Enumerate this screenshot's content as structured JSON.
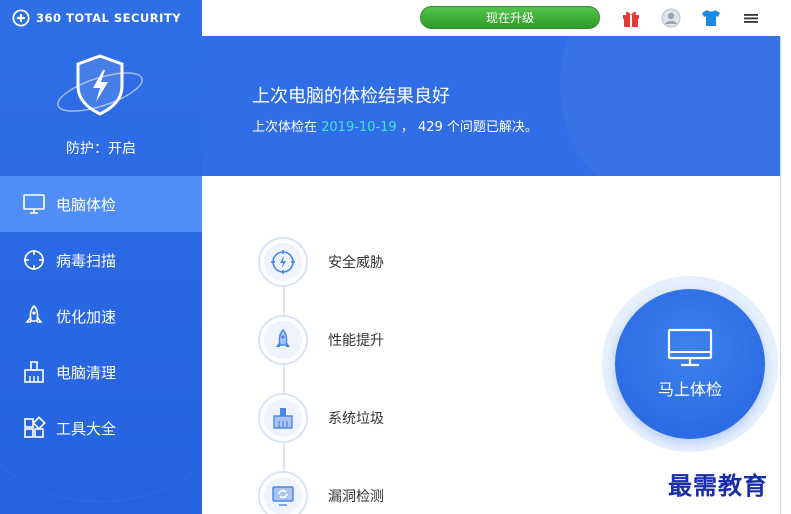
{
  "app": {
    "brand": "360 TOTAL SECURITY"
  },
  "sidebar": {
    "protection_status": "防护：开启",
    "items": [
      {
        "label": "电脑体检",
        "icon": "monitor-icon",
        "active": true
      },
      {
        "label": "病毒扫描",
        "icon": "crosshair-icon",
        "active": false
      },
      {
        "label": "优化加速",
        "icon": "rocket-icon",
        "active": false
      },
      {
        "label": "电脑清理",
        "icon": "broom-icon",
        "active": false
      },
      {
        "label": "工具大全",
        "icon": "apps-grid-icon",
        "active": false
      }
    ]
  },
  "topbar": {
    "upgrade_label": "现在升级",
    "icons": [
      "gift-icon",
      "avatar-icon",
      "tshirt-icon",
      "menu-icon"
    ]
  },
  "banner": {
    "title": "上次电脑的体检结果良好",
    "sub_prefix": "上次体检在 ",
    "date": "2019-10-19",
    "sub_suffix": " ， 429 个问题已解决。"
  },
  "checks": [
    {
      "label": "安全威胁",
      "icon": "shield-bolt-icon"
    },
    {
      "label": "性能提升",
      "icon": "rocket-icon"
    },
    {
      "label": "系统垃圾",
      "icon": "broom-icon"
    },
    {
      "label": "漏洞检测",
      "icon": "refresh-monitor-icon"
    }
  ],
  "scan_button": {
    "label": "马上体检"
  },
  "watermark": "最需教育",
  "colors": {
    "sidebar": "#2f6fe6",
    "sidebar_active": "#4f8ff5",
    "banner": "#2f6ee6",
    "date_highlight": "#44e1d6",
    "upgrade_green": "#3aa935",
    "scan_button": "#2563df"
  }
}
